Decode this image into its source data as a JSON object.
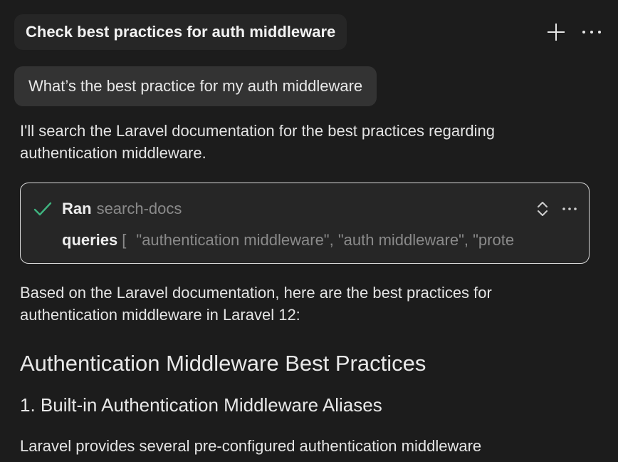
{
  "header": {
    "title": "Check best practices for auth middleware",
    "new_icon": "plus-icon",
    "more_icon": "ellipsis-icon"
  },
  "conversation": {
    "user_message": "What’s the best practice for my auth middleware",
    "assistant_intro": "I'll search the Laravel documentation for the best practices regarding authentication middleware.",
    "tool_call": {
      "status_icon": "check-icon",
      "status_color": "#3fb37f",
      "action_label": "Ran",
      "tool_name": "search-docs",
      "param_label": "queries",
      "param_open": "[",
      "param_values": "\"authentication middleware\", \"auth middleware\", \"prote"
    },
    "assistant_summary": "Based on the Laravel documentation, here are the best practices for authentication middleware in Laravel 12:",
    "heading_main": "Authentication Middleware Best Practices",
    "heading_section": "1. Built-in Authentication Middleware Aliases",
    "section_text": "Laravel provides several pre-configured authentication middleware"
  }
}
